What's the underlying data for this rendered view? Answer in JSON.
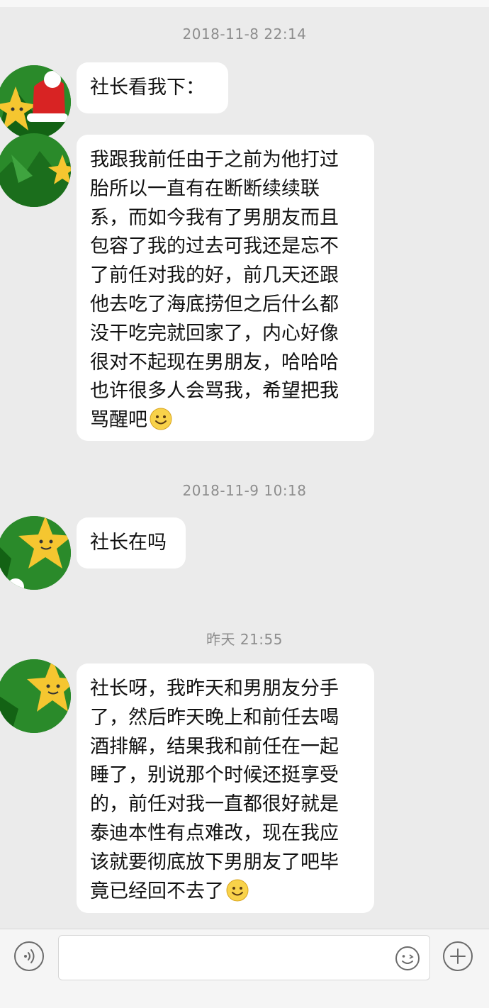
{
  "messages": [
    {
      "timestamp": "2018-11-8 22:14",
      "bubbles": [
        {
          "lines": [
            "社长看我下："
          ]
        },
        {
          "lines": [
            "我跟我前任由于之前为他打过",
            "胎所以一直有在断断续续联",
            "系，而如今我有了男朋友而且",
            "包容了我的过去可我还是忘不",
            "了前任对我的好，前几天还跟",
            "他去吃了海底捞但之后什么都",
            "没干吃完就回家了，内心好像",
            "很对不起现在男朋友，哈哈哈",
            "也许很多人会骂我，希望把我",
            "骂醒吧"
          ],
          "emoji": "smile-emoji"
        }
      ]
    },
    {
      "timestamp": "2018-11-9 10:18",
      "bubbles": [
        {
          "lines": [
            "社长在吗"
          ]
        }
      ]
    },
    {
      "timestamp": "昨天 21:55",
      "bubbles": [
        {
          "lines": [
            "社长呀，我昨天和男朋友分手",
            "了，然后昨天晚上和前任去喝",
            "酒排解，结果我和前任在一起",
            "睡了，别说那个时候还挺享受",
            "的，前任对我一直都很好就是",
            "泰迪本性有点难改，现在我应",
            "该就要彻底放下男朋友了吧毕",
            "竟已经回不去了"
          ],
          "emoji": "smile-emoji"
        }
      ]
    }
  ],
  "input_bar": {
    "placeholder": "",
    "icons": [
      "voice-icon",
      "emoji-icon",
      "plus-icon"
    ]
  },
  "colors": {
    "background": "#ebebeb",
    "bubble": "#ffffff",
    "timestamp_text": "#8d8d8d",
    "avatar_green": "#1f7a21",
    "star_yellow": "#f5c630",
    "hat_red": "#d82323"
  }
}
